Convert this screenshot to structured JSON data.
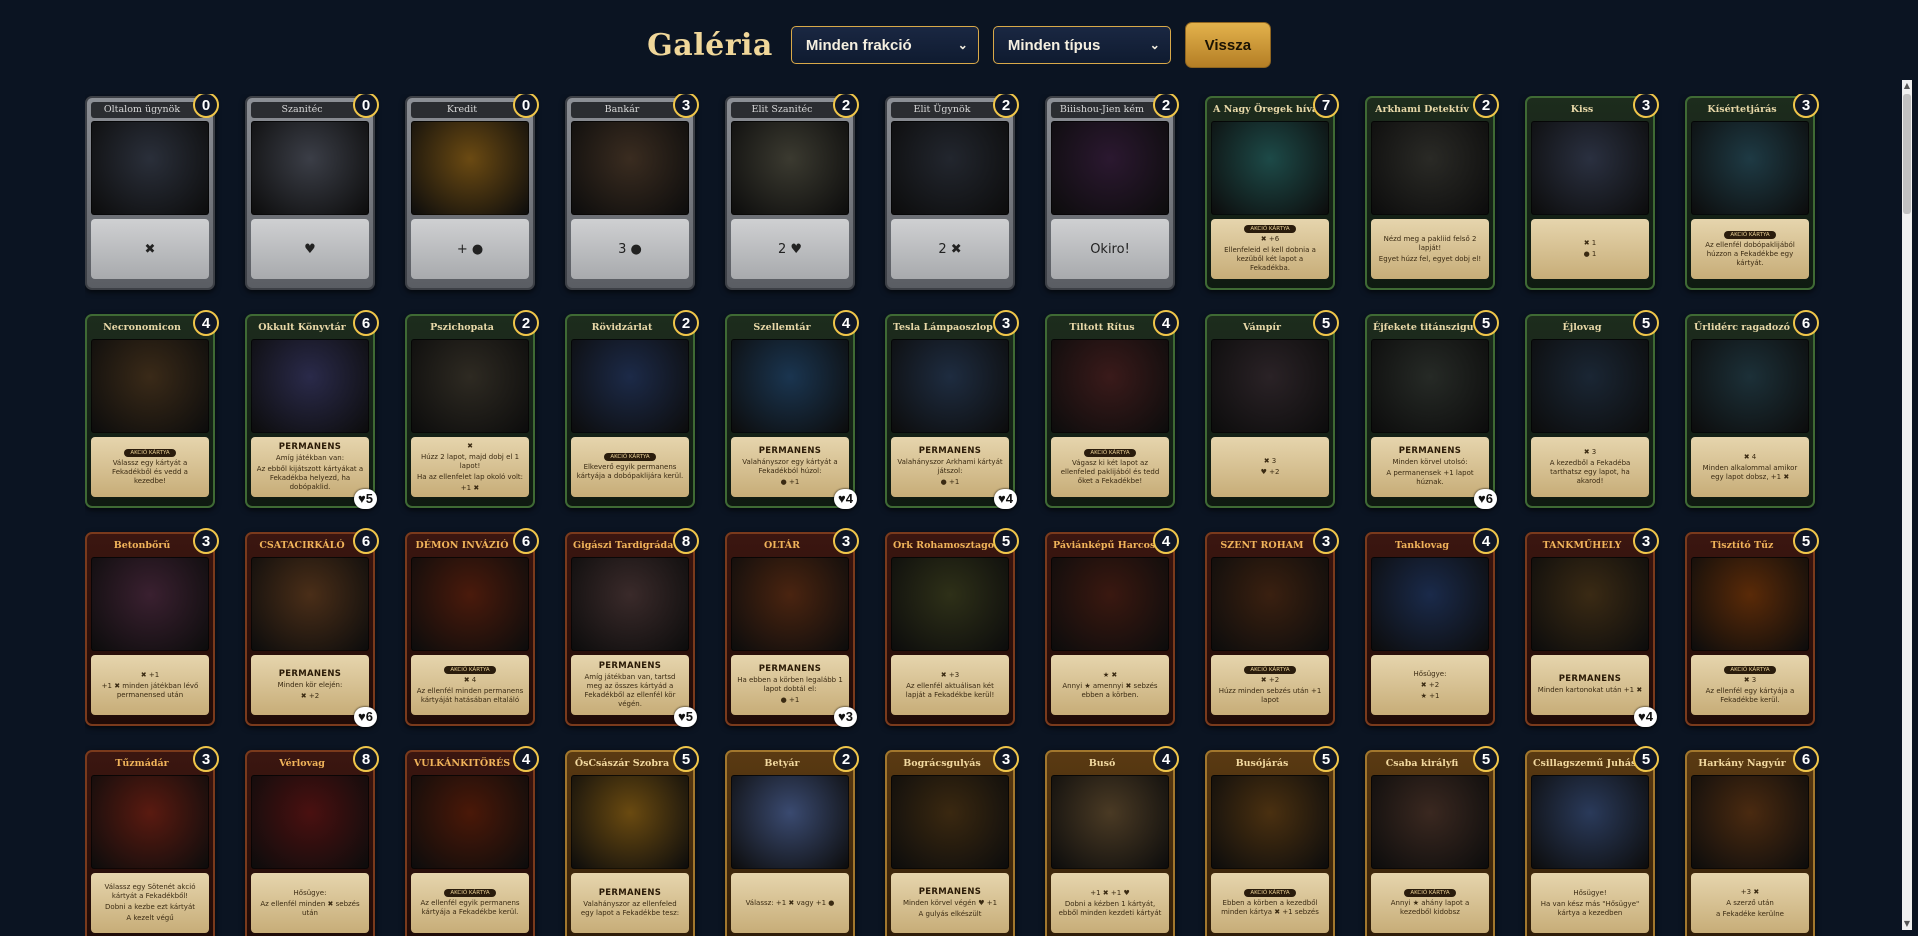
{
  "header": {
    "title": "Galéria",
    "faction_select": "Minden frakció",
    "type_select": "Minden típus",
    "back_label": "Vissza"
  },
  "cards": [
    {
      "name": "Oltalom ügynök",
      "cost": "0",
      "faction": "gray",
      "art": "#2a2f3a",
      "text": [
        "✖"
      ]
    },
    {
      "name": "Szanitéc",
      "cost": "0",
      "faction": "gray",
      "art": "#3b3e47",
      "text": [
        "♥"
      ]
    },
    {
      "name": "Kredit",
      "cost": "0",
      "faction": "gray",
      "art": "#6b4a12",
      "text": [
        "+ ●"
      ]
    },
    {
      "name": "Bankár",
      "cost": "3",
      "faction": "gray",
      "art": "#3a2c20",
      "text": [
        "3 ●"
      ]
    },
    {
      "name": "Elit Szanitéc",
      "cost": "2",
      "faction": "gray",
      "art": "#3b3a30",
      "text": [
        "2 ♥"
      ]
    },
    {
      "name": "Elit Ügynök",
      "cost": "2",
      "faction": "gray",
      "art": "#22262e",
      "text": [
        "2 ✖"
      ]
    },
    {
      "name": "Biiishou-Jien kém",
      "cost": "2",
      "faction": "gray",
      "art": "#2b1830",
      "text": [
        "Okiro!"
      ]
    },
    {
      "name": "A Nagy Öregek hívása",
      "cost": "7",
      "faction": "green",
      "art": "#1d4a48",
      "tag": "AKCIÓ KÁRTYA",
      "text": [
        "✖ +6",
        "Ellenfeleid el kell dobnia a kezüből két lapot a Fekadékba."
      ]
    },
    {
      "name": "Arkhami Detektív",
      "cost": "2",
      "faction": "green",
      "art": "#2a2a26",
      "text": [
        "Nézd meg a pakliid felső 2 lapját!",
        "Egyet húzz fel, egyet dobj el!"
      ]
    },
    {
      "name": "Kiss",
      "cost": "3",
      "faction": "green",
      "art": "#2a3040",
      "text": [
        "✖ 1",
        "● 1"
      ]
    },
    {
      "name": "Kísértetjárás",
      "cost": "3",
      "faction": "green",
      "art": "#1e3a44",
      "tag": "AKCIÓ KÁRTYA",
      "text": [
        "Az ellenfél dobópaklijából húzzon a Fekadékbe egy kártyát."
      ]
    },
    {
      "name": "Necronomicon",
      "cost": "4",
      "faction": "green",
      "art": "#3a2a18",
      "tag": "AKCIÓ KÁRTYA",
      "text": [
        "Válassz egy kártyát a Fekadékből és vedd a kezedbe!"
      ]
    },
    {
      "name": "Okkult Könyvtár",
      "cost": "6",
      "faction": "green",
      "art": "#2a2a4a",
      "kw": "PERMANENS",
      "text": [
        "Amíg játékban van:",
        "Az ebből kijátszott kártyákat a Fekadékba helyezd, ha dobópaklid."
      ],
      "hp": "♥5"
    },
    {
      "name": "Pszichopata",
      "cost": "2",
      "faction": "green",
      "art": "#2e2a22",
      "text": [
        "✖",
        "Húzz 2 lapot, majd dobj el 1 lapot!",
        "Ha az ellenfelet lap okoló volt:",
        "+1 ✖"
      ]
    },
    {
      "name": "Rövidzárlat",
      "cost": "2",
      "faction": "green",
      "art": "#1c2a48",
      "tag": "AKCIÓ KÁRTYA",
      "text": [
        "Elkeverő egyik permanens kártyája a dobópaklijára kerül."
      ]
    },
    {
      "name": "Szellemtár",
      "cost": "4",
      "faction": "green",
      "art": "#1a3550",
      "kw": "PERMANENS",
      "text": [
        "Valahányszor egy kártyát a Fekadékból húzol:",
        "● +1"
      ],
      "hp": "♥4"
    },
    {
      "name": "Tesla Lámpaoszlop",
      "cost": "3",
      "faction": "green",
      "art": "#1e2c40",
      "kw": "PERMANENS",
      "text": [
        "Valahányszor Arkhami kártyát játszol:",
        "● +1"
      ],
      "hp": "♥4"
    },
    {
      "name": "Tiltott Rítus",
      "cost": "4",
      "faction": "green",
      "art": "#3a1a1a",
      "tag": "AKCIÓ KÁRTYA",
      "text": [
        "Vágasz ki két lapot az ellenfeled paklijából és tedd őket a Fekadékbe!"
      ]
    },
    {
      "name": "Vámpír",
      "cost": "5",
      "faction": "green",
      "art": "#2a2226",
      "text": [
        "✖ 3",
        "♥ +2"
      ]
    },
    {
      "name": "Éjfekete titánszigu",
      "cost": "5",
      "faction": "green",
      "art": "#262a26",
      "kw": "PERMANENS",
      "text": [
        "Minden körvel utolsó:",
        "A permanensek +1 lapot húznak."
      ],
      "hp": "♥6"
    },
    {
      "name": "Éjlovag",
      "cost": "5",
      "faction": "green",
      "art": "#1a2634",
      "text": [
        "✖ 3",
        "A kezedből a Fekadéba tarthatsz egy lapot, ha akarod!"
      ]
    },
    {
      "name": "Űrlidérc ragadozó",
      "cost": "6",
      "faction": "green",
      "art": "#1c3038",
      "text": [
        "✖ 4",
        "Minden alkalommal amikor egy lapot dobsz, +1 ✖"
      ]
    },
    {
      "name": "Betonbőrű",
      "cost": "3",
      "faction": "red",
      "art": "#3a2030",
      "text": [
        "✖ +1",
        "+1 ✖ minden játékban lévő permanensed után"
      ]
    },
    {
      "name": "CSATACIRKÁLÓ",
      "cost": "6",
      "faction": "red",
      "art": "#4a2e18",
      "kw": "PERMANENS",
      "text": [
        "Minden kör elején:",
        "✖ +2"
      ],
      "hp": "♥6"
    },
    {
      "name": "DÉMON INVÁZIÓ",
      "cost": "6",
      "faction": "red",
      "art": "#4a1a0c",
      "tag": "AKCIÓ KÁRTYA",
      "text": [
        "✖ 4",
        "Az ellenfél minden permanens kártyáját hatásában eltaláló"
      ]
    },
    {
      "name": "Gigászi Tardigráda",
      "cost": "8",
      "faction": "red",
      "art": "#3a2a2a",
      "kw": "PERMANENS",
      "text": [
        "Amíg játékban van, tartsd meg az összes kártyád a Fekadékből az ellenfél kör végén."
      ],
      "hp": "♥5"
    },
    {
      "name": "OLTÁR",
      "cost": "3",
      "faction": "red",
      "art": "#4a2410",
      "kw": "PERMANENS",
      "text": [
        "Ha ebben a körben legalább 1 lapot dobtál el:",
        "● +1"
      ],
      "hp": "♥3"
    },
    {
      "name": "Ork Rohamosztagos",
      "cost": "5",
      "faction": "red",
      "art": "#2e3018",
      "text": [
        "✖ +3",
        "Az ellenfél aktuálisan két lapját a Fekadékbe kerül!"
      ]
    },
    {
      "name": "Páviánképű Harcos",
      "cost": "4",
      "faction": "red",
      "art": "#3a1810",
      "text": [
        "★ ✖",
        "Annyi ★ amennyi ✖ sebzés ebben a körben."
      ]
    },
    {
      "name": "SZENT ROHAM",
      "cost": "3",
      "faction": "red",
      "art": "#3a2010",
      "tag": "AKCIÓ KÁRTYA",
      "text": [
        "✖ +2",
        "Húzz minden sebzés után +1 lapot"
      ]
    },
    {
      "name": "Tanklovag",
      "cost": "4",
      "faction": "red",
      "art": "#1a2a4a",
      "text": [
        "Hősügye:",
        "✖ +2",
        "★ +1"
      ]
    },
    {
      "name": "TANKMŰHELY",
      "cost": "3",
      "faction": "red",
      "art": "#3a2a14",
      "kw": "PERMANENS",
      "text": [
        "Minden kartonokat után +1 ✖"
      ],
      "hp": "♥4"
    },
    {
      "name": "Tisztító Tűz",
      "cost": "5",
      "faction": "red",
      "art": "#5a2a08",
      "tag": "AKCIÓ KÁRTYA",
      "text": [
        "✖ 3",
        "Az ellenfél egy kártyája a Fekadékbe kerül."
      ]
    },
    {
      "name": "Tűzmádár",
      "cost": "3",
      "faction": "red",
      "art": "#5a1a10",
      "text": [
        "Válassz egy Sötenét akció kártyát a Fekadékből!",
        "Dobni a kezbe ezt kártyát",
        "A kezelt végű"
      ]
    },
    {
      "name": "Vérlovag",
      "cost": "8",
      "faction": "red",
      "art": "#4a1010",
      "text": [
        "Hősügye:",
        "Az ellenfél minden ✖ sebzés után"
      ]
    },
    {
      "name": "VULKÁNKITÖRÉS",
      "cost": "4",
      "faction": "red",
      "art": "#4a1808",
      "tag": "AKCIÓ KÁRTYA",
      "text": [
        "Az ellenfél egyik permanens kártyája a Fekadékbe kerül."
      ]
    },
    {
      "name": "ŐsCsászár Szobra",
      "cost": "5",
      "faction": "gold",
      "art": "#6a4a10",
      "kw": "PERMANENS",
      "text": [
        "Valahányszor az ellenfeled egy lapot a Fekadékbe tesz:"
      ]
    },
    {
      "name": "Betyár",
      "cost": "2",
      "faction": "gold",
      "art": "#3a4a70",
      "text": [
        "Válassz: +1 ✖ vagy +1 ●"
      ]
    },
    {
      "name": "Bográcsgulyás",
      "cost": "3",
      "faction": "gold",
      "art": "#3a2810",
      "kw": "PERMANENS",
      "text": [
        "Minden körvel végén ♥ +1",
        "A gulyás elkészült"
      ]
    },
    {
      "name": "Busó",
      "cost": "4",
      "faction": "gold",
      "art": "#4a3a24",
      "text": [
        "+1 ✖ +1 ♥",
        "Dobni a kézben 1 kártyát, ebből minden kezdeti kártyát"
      ]
    },
    {
      "name": "Busójárás",
      "cost": "5",
      "faction": "gold",
      "art": "#4a3010",
      "tag": "AKCIÓ KÁRTYA",
      "text": [
        "Ebben a körben a kezedből minden kártya ✖ +1 sebzés"
      ]
    },
    {
      "name": "Csaba királyfi",
      "cost": "5",
      "faction": "gold",
      "art": "#3a2820",
      "tag": "AKCIÓ KÁRTYA",
      "text": [
        "Annyi ★ ahány lapot a kezedből kidobsz"
      ]
    },
    {
      "name": "Csillagszemű Juhász",
      "cost": "5",
      "faction": "gold",
      "art": "#2a3a5a",
      "text": [
        "Hősügye!",
        "Ha van kész más \"Hősügye\" kártya a kezedben"
      ]
    },
    {
      "name": "Harkány Nagyúr",
      "cost": "6",
      "faction": "gold",
      "art": "#4a2a10",
      "text": [
        "+3 ✖",
        "A szerző után",
        "a Fekadéke kerülne"
      ]
    }
  ],
  "colors": {
    "background": "#0b1422",
    "gold_accent": "#f0c64a",
    "button": "#d9a949"
  }
}
